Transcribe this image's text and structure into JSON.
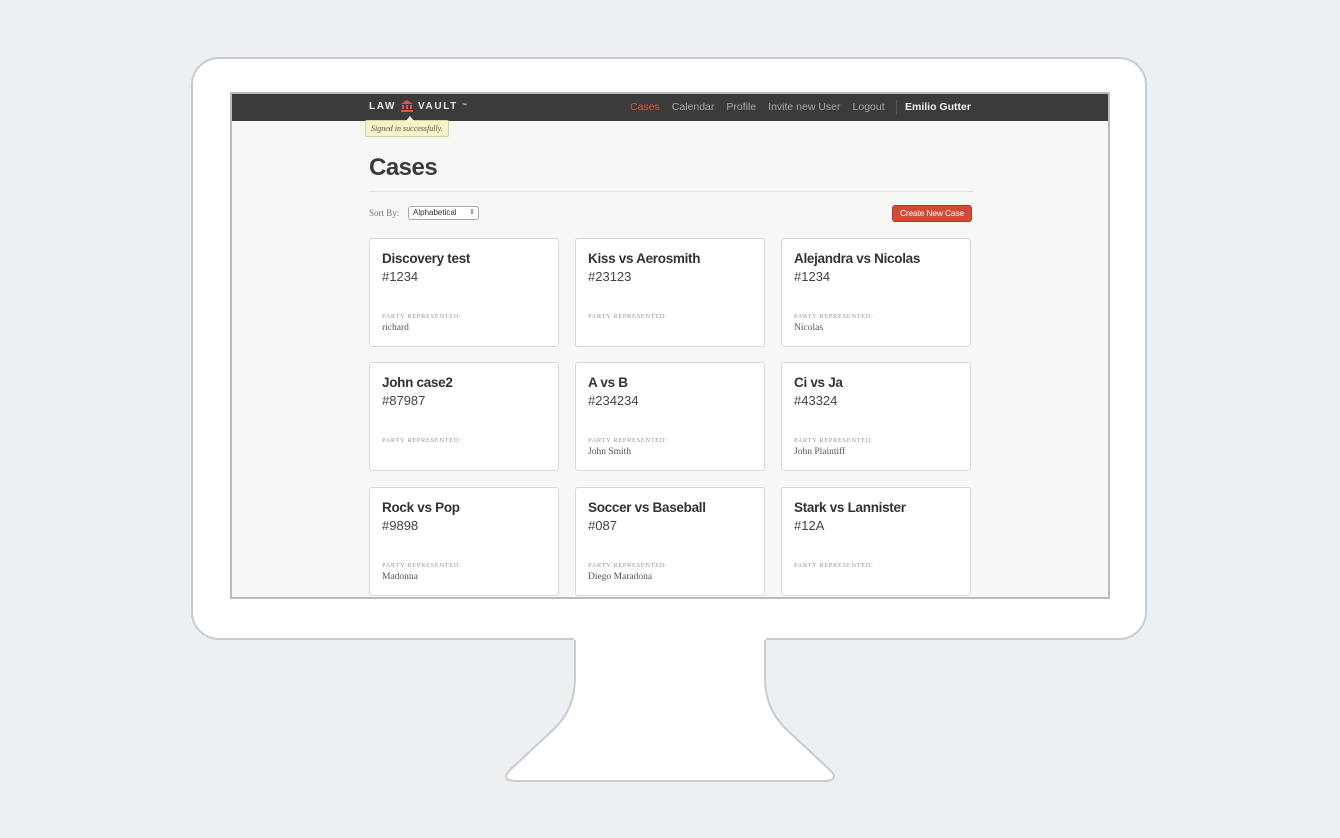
{
  "app": {
    "logo_left": "LAW",
    "logo_right": "VAULT",
    "logo_tm": "™",
    "nav": [
      "Cases",
      "Calendar",
      "Profile",
      "Invite new User",
      "Logout"
    ],
    "active_nav": "Cases",
    "user_name": "Emilio Gutter",
    "flash": "Signed in successfully."
  },
  "page": {
    "title": "Cases",
    "sort_label": "Sort By:",
    "sort_value": "Alphabetical",
    "sort_arrows": "⇕",
    "create_button": "Create New Case",
    "party_label": "PARTY REPRESENTED:"
  },
  "cases": [
    {
      "title": "Discovery test",
      "number": "#1234",
      "party": "richard"
    },
    {
      "title": "Kiss vs Aerosmith",
      "number": "#23123",
      "party": ""
    },
    {
      "title": "Alejandra vs Nicolas",
      "number": "#1234",
      "party": "Nicolas"
    },
    {
      "title": "John case2",
      "number": "#87987",
      "party": ""
    },
    {
      "title": "A vs B",
      "number": "#234234",
      "party": "John Smith"
    },
    {
      "title": "Ci vs Ja",
      "number": "#43324",
      "party": "John Plaintiff"
    },
    {
      "title": "Rock vs Pop",
      "number": "#9898",
      "party": "Madonna"
    },
    {
      "title": "Soccer vs Baseball",
      "number": "#087",
      "party": "Diego Maradona"
    },
    {
      "title": "Stark vs Lannister",
      "number": "#12A",
      "party": ""
    }
  ],
  "colors": {
    "accent": "#d24a36",
    "navbar": "#3b3b3b",
    "background": "#edf0f3"
  }
}
